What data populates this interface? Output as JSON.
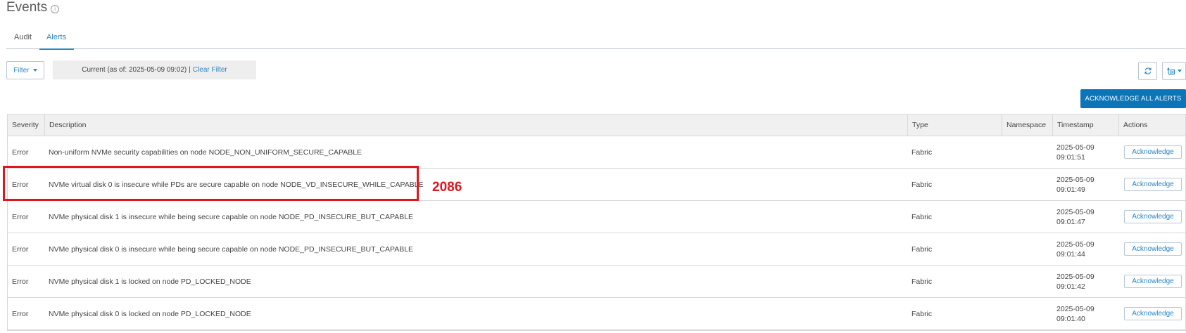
{
  "header": {
    "title": "Events",
    "info_icon": "info-circle-icon"
  },
  "tabs": [
    {
      "label": "Audit",
      "active": false
    },
    {
      "label": "Alerts",
      "active": true
    }
  ],
  "filter": {
    "button_label": "Filter",
    "summary_text": "Current (as of: 2025-05-09 09:02)",
    "separator": "|",
    "clear_label": "Clear Filter"
  },
  "toolbar": {
    "refresh_icon": "refresh-icon",
    "export_icon": "export-icon",
    "ack_all_label": "ACKNOWLEDGE ALL ALERTS"
  },
  "table": {
    "columns": [
      "Severity",
      "Description",
      "Type",
      "Namespace",
      "Timestamp",
      "Actions"
    ],
    "rows": [
      {
        "severity": "Error",
        "description": "Non-uniform NVMe security capabilities on node NODE_NON_UNIFORM_SECURE_CAPABLE",
        "type": "Fabric",
        "namespace": "",
        "date": "2025-05-09",
        "time": "09:01:51",
        "action": "Acknowledge"
      },
      {
        "severity": "Error",
        "description": "NVMe virtual disk 0 is insecure while PDs are secure capable on node NODE_VD_INSECURE_WHILE_CAPABLE",
        "type": "Fabric",
        "namespace": "",
        "date": "2025-05-09",
        "time": "09:01:49",
        "action": "Acknowledge"
      },
      {
        "severity": "Error",
        "description": "NVMe physical disk 1 is insecure while being secure capable on node NODE_PD_INSECURE_BUT_CAPABLE",
        "type": "Fabric",
        "namespace": "",
        "date": "2025-05-09",
        "time": "09:01:47",
        "action": "Acknowledge"
      },
      {
        "severity": "Error",
        "description": "NVMe physical disk 0 is insecure while being secure capable on node NODE_PD_INSECURE_BUT_CAPABLE",
        "type": "Fabric",
        "namespace": "",
        "date": "2025-05-09",
        "time": "09:01:44",
        "action": "Acknowledge"
      },
      {
        "severity": "Error",
        "description": "NVMe physical disk 1 is locked on node PD_LOCKED_NODE",
        "type": "Fabric",
        "namespace": "",
        "date": "2025-05-09",
        "time": "09:01:42",
        "action": "Acknowledge"
      },
      {
        "severity": "Error",
        "description": "NVMe physical disk 0 is locked on node PD_LOCKED_NODE",
        "type": "Fabric",
        "namespace": "",
        "date": "2025-05-09",
        "time": "09:01:40",
        "action": "Acknowledge"
      }
    ]
  },
  "annotation": {
    "text": "2086",
    "color": "#e0161e"
  },
  "colors": {
    "accent": "#2a86c4",
    "primary_button": "#0c75b8"
  }
}
